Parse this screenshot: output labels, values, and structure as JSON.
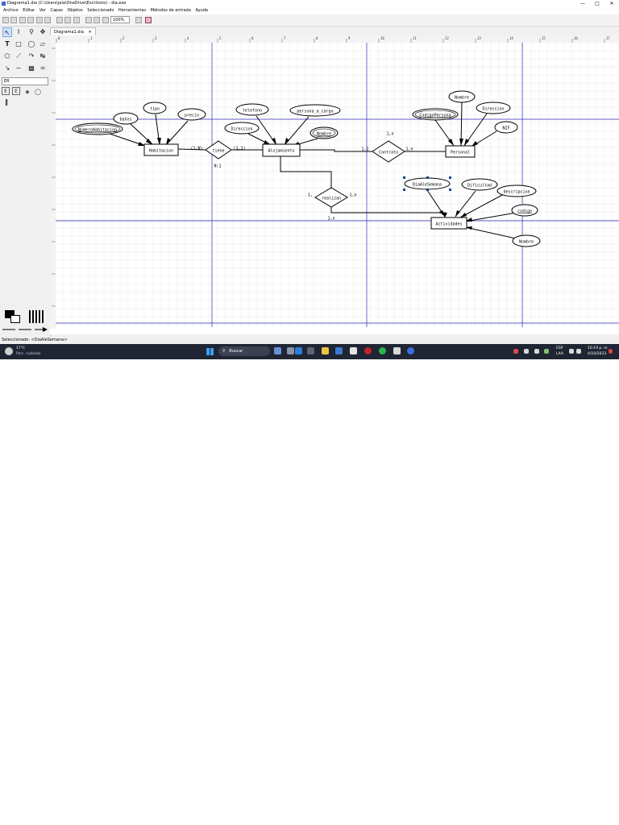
{
  "window": {
    "title": "Diagrama1.dia (C:\\Users\\jala\\OneDrive\\Escritorio) - dia.exe",
    "controls": [
      "—",
      "□",
      "✕"
    ]
  },
  "menu": [
    "Archivo",
    "Editar",
    "Ver",
    "Capas",
    "Objetos",
    "Seleccionado",
    "Herramientas",
    "Métodos de entrada",
    "Ayuda"
  ],
  "toolbar": {
    "zoom": "100%"
  },
  "toolbox": {
    "sheet": "ER"
  },
  "tabs": [
    {
      "label": "Diagrama1.dia"
    }
  ],
  "tab_close": "✕",
  "diagram": {
    "ruler_marks": [
      "0",
      "1",
      "2",
      "3",
      "4",
      "5",
      "6",
      "7",
      "8",
      "9",
      "10",
      "11",
      "12",
      "13",
      "14",
      "15",
      "16",
      "17"
    ],
    "entities": [
      "Habitacion",
      "Alojamiento",
      "Personal",
      "Actividades"
    ],
    "relationships": [
      "tiene",
      "Contrato",
      "realizan"
    ],
    "attributes": {
      "habitacion": [
        "NumeroHabitacion",
        "baños",
        "tipo",
        "precio"
      ],
      "alojamiento": [
        "telefono",
        "persona_a_cargo",
        "Direccion",
        "Nombre"
      ],
      "personal": [
        "CodigoPersona",
        "Nombre",
        "Direccion",
        "NIF"
      ],
      "actividades": [
        "DiaAleSemana",
        "Dificultad",
        "descripcion",
        "codigo",
        "Nombre"
      ]
    },
    "cardinalities": [
      "(1,N)",
      "(1,1)",
      "N:1",
      "1,n",
      "1,1",
      "1,n",
      "1,",
      "1,n",
      "1,n"
    ]
  },
  "status": {
    "text": "Seleccionado: <DiaAleSemana>"
  },
  "taskbar": {
    "weather_temp": "17°C",
    "weather_desc": "Parc. nublado",
    "search": "Buscar",
    "lang": "ESP",
    "lang2": "LAA",
    "time": "10:19 p. m.",
    "date": "4/10/2023"
  },
  "colors": {
    "grid_major": "#2b2bb8",
    "grid_minor": "#e3e9e3",
    "taskbar": "#1f2533",
    "select": "#1a3c9e"
  }
}
